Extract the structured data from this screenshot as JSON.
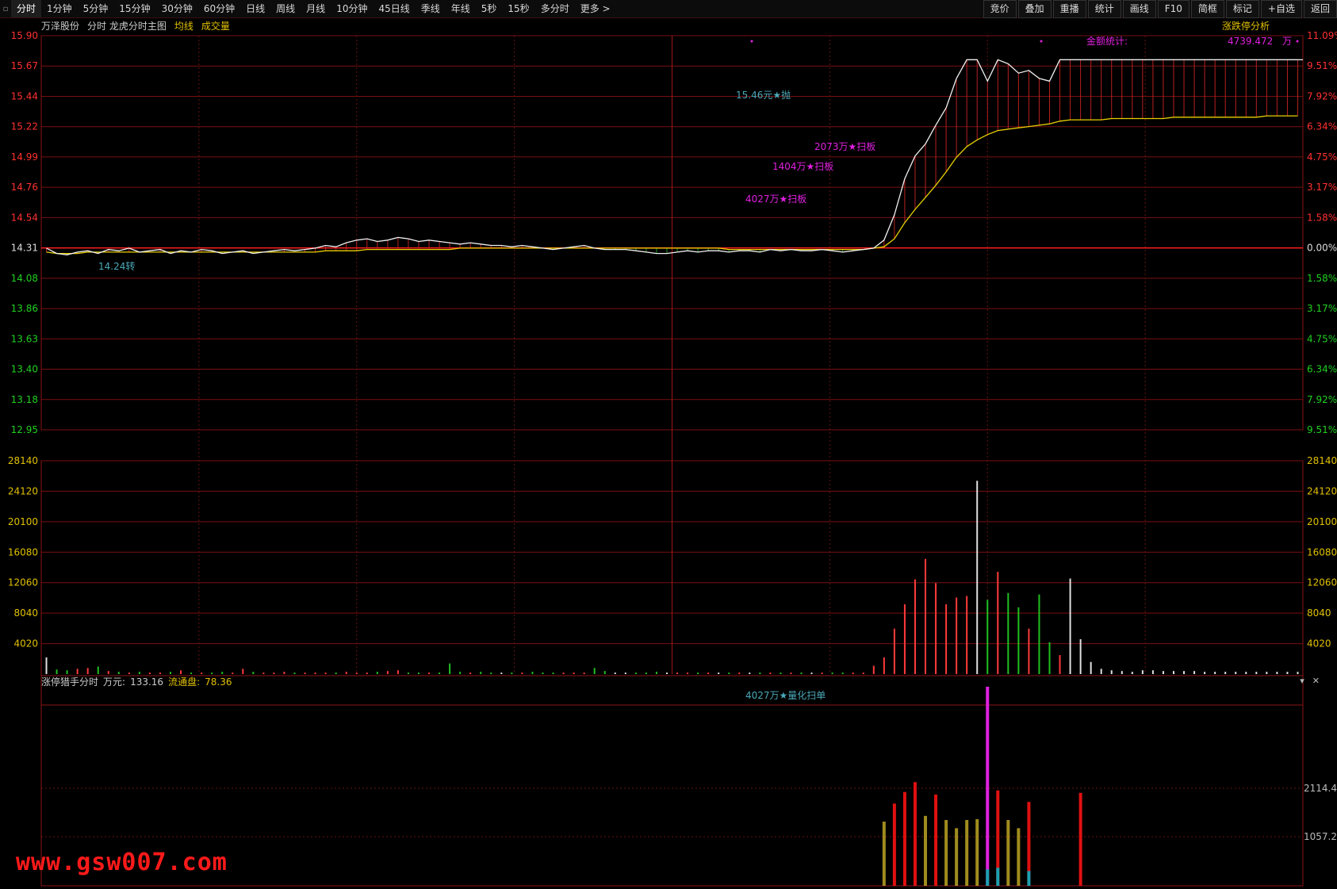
{
  "toolbar": {
    "tabs": [
      "分时",
      "1分钟",
      "5分钟",
      "15分钟",
      "30分钟",
      "60分钟",
      "日线",
      "周线",
      "月线",
      "10分钟",
      "45日线",
      "季线",
      "年线",
      "5秒",
      "15秒",
      "多分时",
      "更多 >"
    ],
    "active_tab": "分时",
    "right_buttons": [
      "竞价",
      "叠加",
      "重播",
      "统计",
      "画线",
      "F10",
      "简框",
      "标记",
      "+自选",
      "返回"
    ]
  },
  "chart_header": {
    "stock_name": "万泽股份",
    "mode": "分时 龙虎分时主图",
    "avg_label": "均线",
    "volume_label": "成交量",
    "limit_analysis": "涨跌停分析",
    "amount_stat_label": "金额统计:",
    "amount_stat_value": "4739.472",
    "amount_stat_unit": "万"
  },
  "price_axis": {
    "left_labels": [
      "15.90",
      "15.67",
      "15.44",
      "15.22",
      "14.99",
      "14.76",
      "14.54",
      "14.31",
      "14.08",
      "13.86",
      "13.63",
      "13.40",
      "13.18",
      "12.95"
    ],
    "right_labels": [
      "11.09%",
      "9.51%",
      "7.92%",
      "6.34%",
      "4.75%",
      "3.17%",
      "1.58%",
      "0.00%",
      "1.58%",
      "3.17%",
      "4.75%",
      "6.34%",
      "7.92%",
      "9.51%"
    ]
  },
  "volume_axis": {
    "labels": [
      "28140",
      "24120",
      "20100",
      "16080",
      "12060",
      "8040",
      "4020"
    ]
  },
  "annotations": {
    "sell": "15.46元★抛",
    "support": "14.24转",
    "sweep1": "2073万★扫板",
    "sweep2": "1404万★扫板",
    "sweep3": "4027万★扫板",
    "quant": "4027万★量化扫单"
  },
  "indicator": {
    "name": "涨停猎手分时",
    "unit_label": "万元:",
    "unit_value": "133.16",
    "float_label": "流通盘:",
    "float_value": "78.36",
    "axis_labels": [
      "2114.47",
      "1057.23"
    ]
  },
  "watermark": "www.gsw007.com",
  "chart_data": {
    "type": "line",
    "series": [],
    "prev_close": 14.31,
    "ylim": [
      12.95,
      15.9
    ],
    "price_points": [
      14.31,
      14.27,
      14.26,
      14.28,
      14.29,
      14.27,
      14.3,
      14.29,
      14.31,
      14.28,
      14.29,
      14.3,
      14.27,
      14.29,
      14.28,
      14.3,
      14.29,
      14.27,
      14.28,
      14.29,
      14.27,
      14.28,
      14.29,
      14.3,
      14.29,
      14.3,
      14.31,
      14.33,
      14.32,
      14.35,
      14.37,
      14.38,
      14.36,
      14.37,
      14.39,
      14.38,
      14.36,
      14.37,
      14.36,
      14.35,
      14.34,
      14.35,
      14.34,
      14.33,
      14.33,
      14.32,
      14.33,
      14.32,
      14.31,
      14.3,
      14.31,
      14.32,
      14.33,
      14.31,
      14.3,
      14.3,
      14.3,
      14.29,
      14.28,
      14.27,
      14.27,
      14.28,
      14.29,
      14.28,
      14.29,
      14.29,
      14.28,
      14.29,
      14.29,
      14.28,
      14.3,
      14.29,
      14.3,
      14.29,
      14.29,
      14.3,
      14.29,
      14.28,
      14.29,
      14.3,
      14.31,
      14.37,
      14.56,
      14.83,
      15.0,
      15.09,
      15.23,
      15.36,
      15.58,
      15.72,
      15.72,
      15.56,
      15.72,
      15.69,
      15.62,
      15.64,
      15.58,
      15.56,
      15.72,
      15.72,
      15.72,
      15.72,
      15.72,
      15.72,
      15.72,
      15.72,
      15.72,
      15.72,
      15.72,
      15.72,
      15.72,
      15.72,
      15.72,
      15.72,
      15.72,
      15.72,
      15.72,
      15.72,
      15.72,
      15.72,
      15.72,
      15.72
    ],
    "avg_points": [
      14.28,
      14.27,
      14.27,
      14.27,
      14.28,
      14.28,
      14.28,
      14.28,
      14.28,
      14.28,
      14.28,
      14.28,
      14.28,
      14.28,
      14.28,
      14.28,
      14.28,
      14.28,
      14.28,
      14.28,
      14.28,
      14.28,
      14.28,
      14.28,
      14.28,
      14.28,
      14.28,
      14.29,
      14.29,
      14.29,
      14.29,
      14.3,
      14.3,
      14.3,
      14.3,
      14.3,
      14.3,
      14.3,
      14.3,
      14.3,
      14.31,
      14.31,
      14.31,
      14.31,
      14.31,
      14.31,
      14.31,
      14.31,
      14.31,
      14.31,
      14.31,
      14.31,
      14.31,
      14.31,
      14.31,
      14.31,
      14.31,
      14.31,
      14.31,
      14.31,
      14.31,
      14.31,
      14.31,
      14.31,
      14.31,
      14.31,
      14.3,
      14.3,
      14.3,
      14.3,
      14.3,
      14.3,
      14.3,
      14.3,
      14.3,
      14.3,
      14.3,
      14.3,
      14.3,
      14.3,
      14.31,
      14.32,
      14.38,
      14.5,
      14.6,
      14.69,
      14.78,
      14.88,
      14.99,
      15.07,
      15.12,
      15.16,
      15.19,
      15.2,
      15.21,
      15.22,
      15.23,
      15.24,
      15.26,
      15.27,
      15.27,
      15.27,
      15.27,
      15.28,
      15.28,
      15.28,
      15.28,
      15.28,
      15.28,
      15.29,
      15.29,
      15.29,
      15.29,
      15.29,
      15.29,
      15.29,
      15.29,
      15.29,
      15.3,
      15.3,
      15.3,
      15.3
    ],
    "volume_ylim": [
      0,
      28140
    ],
    "volume_bars": [
      2200,
      600,
      500,
      700,
      800,
      1000,
      400,
      300,
      200,
      300,
      200,
      200,
      300,
      500,
      200,
      200,
      200,
      300,
      200,
      700,
      300,
      200,
      200,
      300,
      200,
      200,
      200,
      200,
      200,
      300,
      200,
      200,
      300,
      400,
      500,
      200,
      200,
      200,
      200,
      1400,
      300,
      200,
      300,
      200,
      200,
      200,
      200,
      300,
      200,
      200,
      200,
      200,
      200,
      800,
      400,
      200,
      200,
      200,
      200,
      300,
      200,
      200,
      200,
      200,
      200,
      200,
      200,
      200,
      200,
      200,
      200,
      200,
      200,
      200,
      200,
      200,
      200,
      200,
      200,
      200,
      1100,
      2200,
      6000,
      9200,
      12500,
      15200,
      12000,
      9200,
      10100,
      10300,
      25500,
      9800,
      13500,
      10700,
      8800,
      6000,
      10500,
      4200,
      2500,
      12600,
      4600,
      1600,
      700,
      500,
      400,
      300,
      500,
      500,
      400,
      400,
      400,
      400,
      300,
      300,
      300,
      300,
      300,
      300,
      300,
      300,
      300,
      300
    ],
    "indicator_ylim": [
      0,
      2400
    ],
    "indicator_bars": [
      {
        "i": 81,
        "v": 780,
        "c": "#a08c1e"
      },
      {
        "i": 82,
        "v": 1000,
        "c": "#e01010"
      },
      {
        "i": 83,
        "v": 1140,
        "c": "#e01010"
      },
      {
        "i": 84,
        "v": 1260,
        "c": "#e01010"
      },
      {
        "i": 85,
        "v": 850,
        "c": "#a08c1e"
      },
      {
        "i": 86,
        "v": 1110,
        "c": "#e01010"
      },
      {
        "i": 87,
        "v": 800,
        "c": "#a08c1e"
      },
      {
        "i": 88,
        "v": 700,
        "c": "#a08c1e"
      },
      {
        "i": 89,
        "v": 800,
        "c": "#a08c1e"
      },
      {
        "i": 90,
        "v": 810,
        "c": "#a08c1e"
      },
      {
        "i": 91,
        "v": 2420,
        "c": "#e020e0"
      },
      {
        "i": 92,
        "v": 1160,
        "c": "#e01010"
      },
      {
        "i": 93,
        "v": 800,
        "c": "#a08c1e"
      },
      {
        "i": 94,
        "v": 700,
        "c": "#a08c1e"
      },
      {
        "i": 95,
        "v": 1020,
        "c": "#e01010"
      },
      {
        "i": 100,
        "v": 1130,
        "c": "#e01010"
      }
    ]
  }
}
